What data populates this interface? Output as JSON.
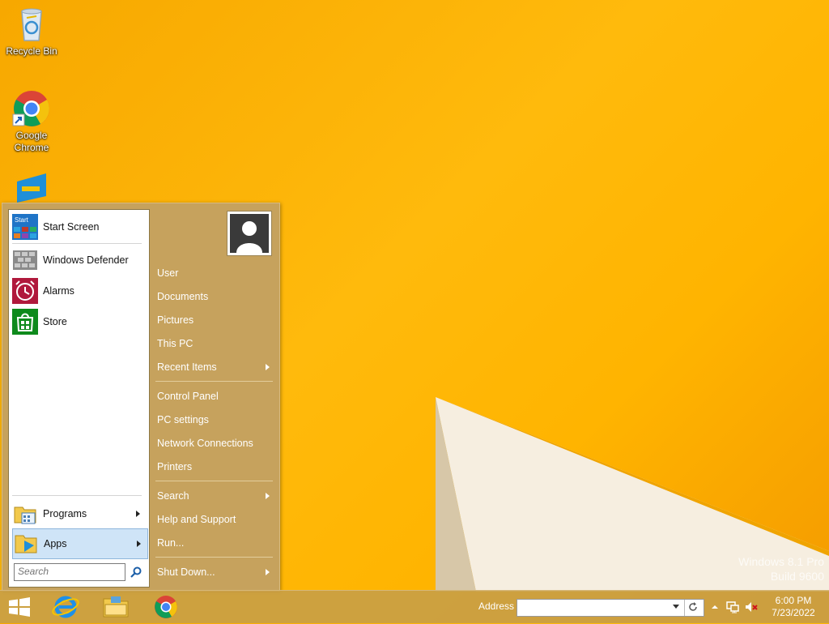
{
  "desktop": {
    "icons": [
      {
        "label": "Recycle Bin"
      },
      {
        "label": "Google Chrome"
      }
    ],
    "watermark_line1": "Windows 8.1 Pro",
    "watermark_line2": "Build 9600"
  },
  "start_menu": {
    "pinned": [
      {
        "label": "Start Screen",
        "icon": "start-screen-icon",
        "icon_text": "Start"
      },
      {
        "label": "Windows Defender",
        "icon": "windows-defender-icon"
      },
      {
        "label": "Alarms",
        "icon": "alarm-clock-icon"
      },
      {
        "label": "Store",
        "icon": "store-bag-icon"
      }
    ],
    "programs_label": "Programs",
    "apps_label": "Apps",
    "search_placeholder": "Search",
    "right_items": [
      {
        "label": "User"
      },
      {
        "label": "Documents"
      },
      {
        "label": "Pictures"
      },
      {
        "label": "This PC"
      },
      {
        "label": "Recent Items",
        "submenu": true
      },
      {
        "label": "Control Panel"
      },
      {
        "label": "PC settings"
      },
      {
        "label": "Network Connections"
      },
      {
        "label": "Printers"
      },
      {
        "label": "Search",
        "submenu": true
      },
      {
        "label": "Help and Support"
      },
      {
        "label": "Run..."
      },
      {
        "label": "Shut Down...",
        "submenu": true
      }
    ]
  },
  "taskbar": {
    "pinned": [
      "start-button",
      "internet-explorer-icon",
      "file-explorer-icon",
      "chrome-icon"
    ],
    "address_label": "Address",
    "address_value": "",
    "tray": [
      "show-hidden-icons",
      "network-icon",
      "volume-muted-icon"
    ],
    "clock_time": "6:00 PM",
    "clock_date": "7/23/2022"
  },
  "colors": {
    "desktop": "#ffb400",
    "start_menu": "#c6a25d",
    "apps_highlight": "#cfe4f7",
    "alarms_tile": "#b0193c",
    "store_tile": "#0e8a1c"
  }
}
